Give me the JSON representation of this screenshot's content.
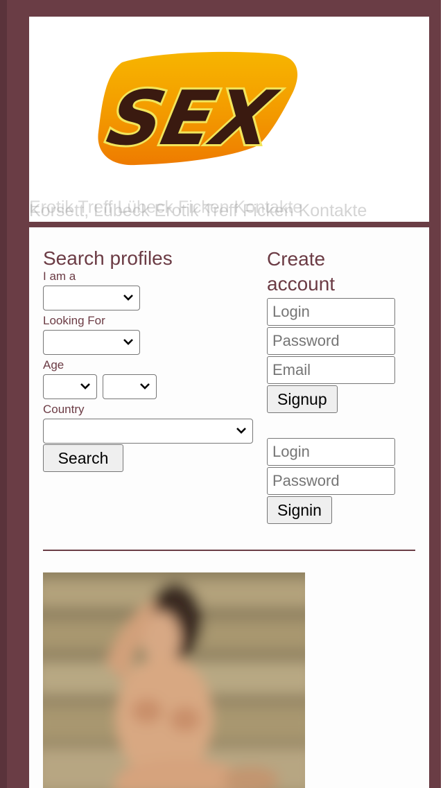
{
  "colors": {
    "frame": "#6a3d45",
    "accent_text": "#6b3b44"
  },
  "header": {
    "logo_text": "SEX",
    "tagline_primary": "Korsett, Lübeck Erotik Treff Ficken Kontakte",
    "tagline_overlay": "Erotik Treff Lübeck Ficken Kontakte"
  },
  "search": {
    "title": "Search profiles",
    "i_am_label": "I am a",
    "looking_for_label": "Looking For",
    "age_label": "Age",
    "country_label": "Country",
    "i_am_value": "",
    "looking_for_value": "",
    "age_from_value": "",
    "age_to_value": "",
    "country_value": "",
    "button_label": "Search"
  },
  "signup": {
    "title": "Create account",
    "login_placeholder": "Login",
    "password_placeholder": "Password",
    "email_placeholder": "Email",
    "button_label": "Signup"
  },
  "signin": {
    "login_placeholder": "Login",
    "password_placeholder": "Password",
    "button_label": "Signin"
  },
  "profile_photo": {
    "description_icon": "blurred-profile-photo"
  }
}
